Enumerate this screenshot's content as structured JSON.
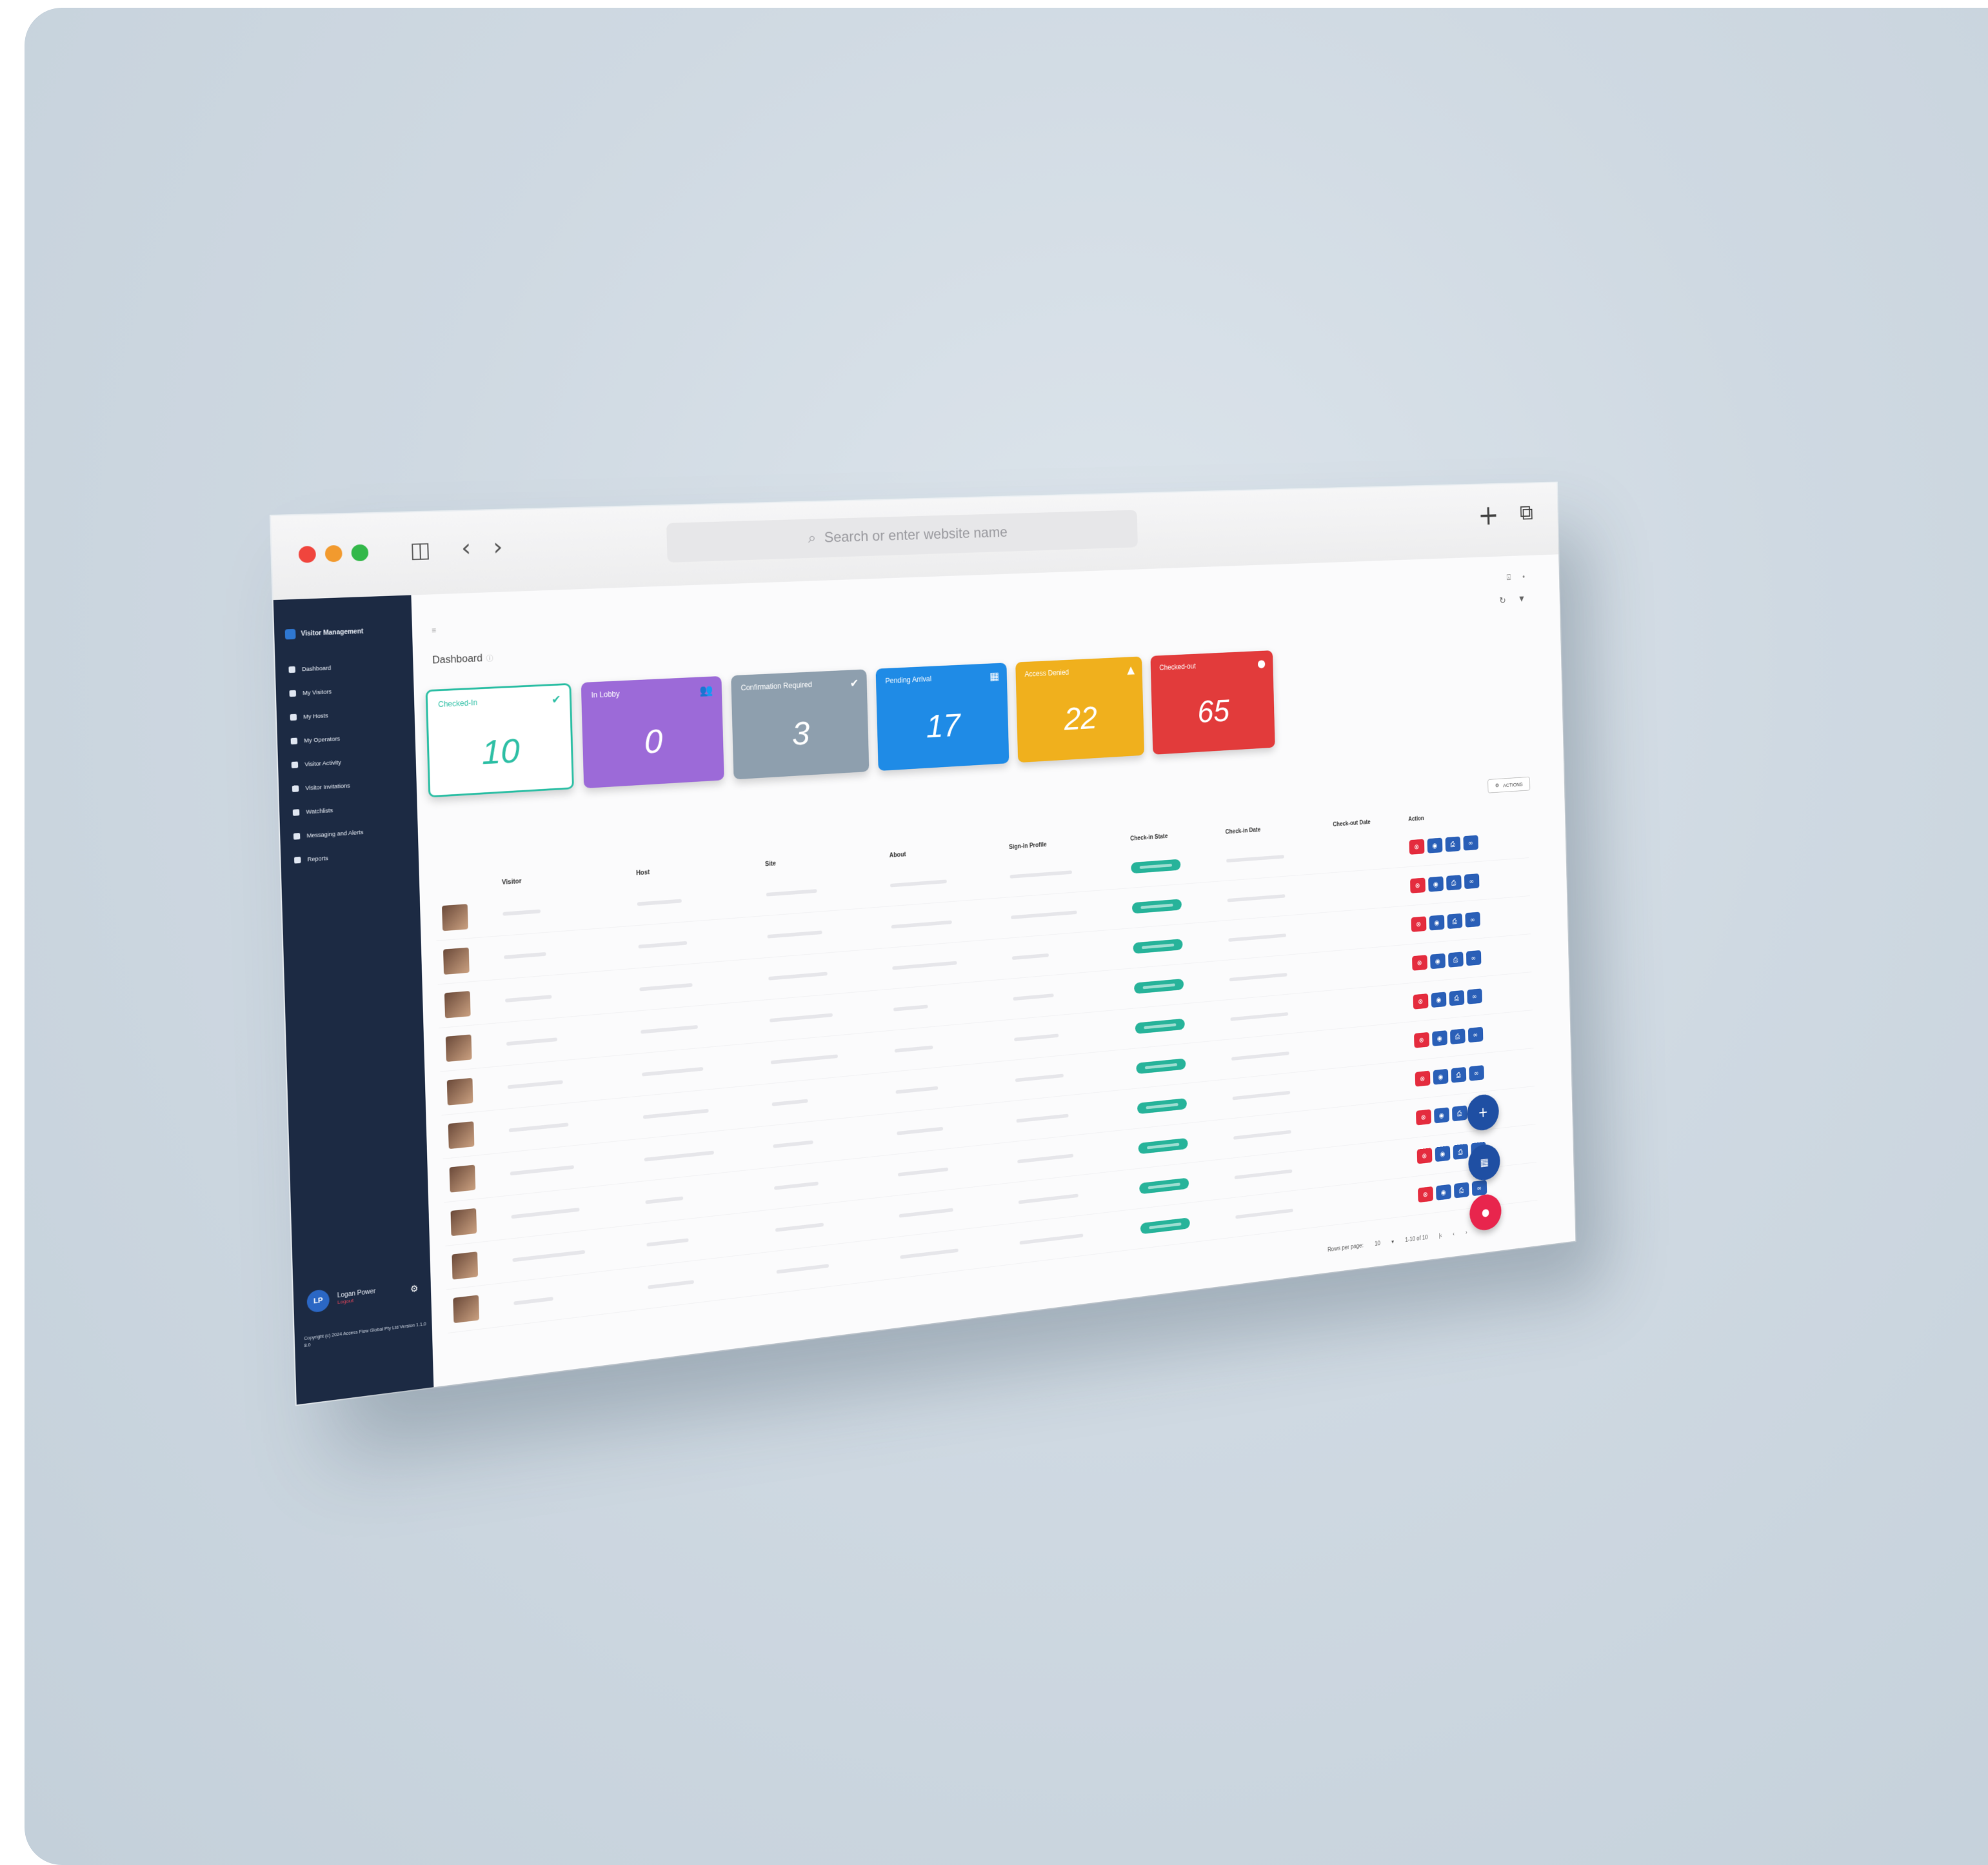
{
  "browser": {
    "address_placeholder": "Search or enter website name",
    "icons": [
      "sidebar-toggle-icon",
      "back-icon",
      "forward-icon",
      "search-icon",
      "new-tab-icon",
      "tabs-icon"
    ]
  },
  "sidebar": {
    "brand": "Visitor Management",
    "items": [
      {
        "label": "Dashboard"
      },
      {
        "label": "My Visitors"
      },
      {
        "label": "My Hosts"
      },
      {
        "label": "My Operators"
      },
      {
        "label": "Visitor Activity"
      },
      {
        "label": "Visitor Invitations"
      },
      {
        "label": "Watchlists"
      },
      {
        "label": "Messaging and Alerts"
      },
      {
        "label": "Reports"
      }
    ],
    "user": {
      "initials": "LP",
      "name": "Logan Power",
      "status": "Logout"
    },
    "copyright": "Copyright (c) 2024 Access Flow Global Pty Ltd Version 1.1.0 8.0"
  },
  "page": {
    "title": "Dashboard",
    "actions_label": "ACTIONS"
  },
  "cards": [
    {
      "label": "Checked-In",
      "value": "10",
      "color": "#2ebfa5",
      "icon": "check-circle-icon",
      "glyph": "✔"
    },
    {
      "label": "In Lobby",
      "value": "0",
      "color": "#9c6ad8",
      "icon": "people-icon",
      "glyph": "👥"
    },
    {
      "label": "Confirmation Required",
      "value": "3",
      "color": "#8e9fae",
      "icon": "check-badge-icon",
      "glyph": "✔"
    },
    {
      "label": "Pending Arrival",
      "value": "17",
      "color": "#1f8be6",
      "icon": "calendar-icon",
      "glyph": "▦"
    },
    {
      "label": "Access Denied",
      "value": "22",
      "color": "#f0b01d",
      "icon": "warning-icon",
      "glyph": "▲"
    },
    {
      "label": "Checked-out",
      "value": "65",
      "color": "#e23b3b",
      "icon": "exit-icon",
      "glyph": "●"
    }
  ],
  "table": {
    "columns": [
      "Visitor",
      "Host",
      "Site",
      "About",
      "Sign-in Profile",
      "Check-in State",
      "Check-in Date",
      "Check-out Date",
      "Action"
    ]
  },
  "pagination": {
    "rows_label": "Rows per page:",
    "rows_value": "10",
    "range": "1-10 of 10"
  }
}
